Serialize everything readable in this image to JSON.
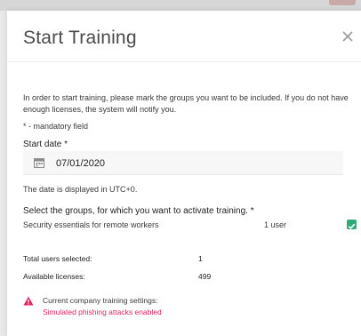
{
  "dialog": {
    "title": "Start Training",
    "intro": "In order to start training, please mark the groups you want to be included. If you do not have enough licenses, the system will notify you.",
    "mandatory_note": "* - mandatory field"
  },
  "start_date": {
    "label": "Start date *",
    "value": "07/01/2020",
    "timezone_note": "The date is displayed in UTC+0."
  },
  "groups": {
    "label": "Select the groups, for which you want to activate training. *",
    "items": [
      {
        "name": "Security essentials for remote workers",
        "users": "1 user",
        "checked": true
      }
    ]
  },
  "summary": {
    "total_users_label": "Total users selected:",
    "total_users_value": "1",
    "licenses_label": "Available licenses:",
    "licenses_value": "499"
  },
  "warning": {
    "title": "Current company training settings:",
    "subtitle": "Simulated phishing attacks enabled"
  },
  "colors": {
    "accent_green": "#2faa78",
    "warning_red": "#e0245e"
  },
  "icons": [
    "close-icon",
    "calendar-icon",
    "checkmark-icon",
    "warning-icon"
  ]
}
